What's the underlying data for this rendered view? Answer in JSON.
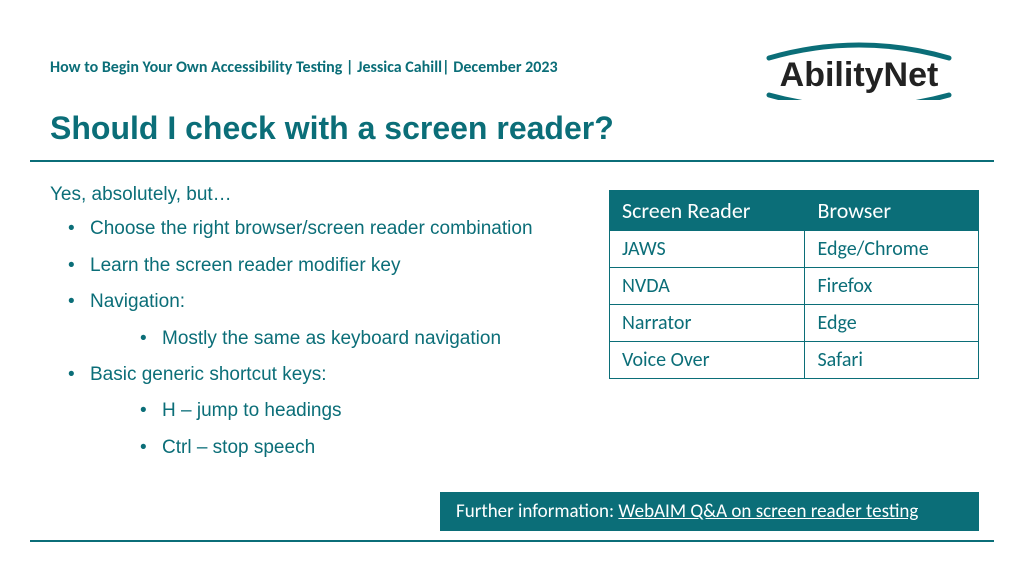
{
  "header": "How to Begin Your Own Accessibility Testing | Jessica Cahill| December 2023",
  "logo_text": "AbilityNet",
  "title": "Should I check with a screen reader?",
  "intro": "Yes, absolutely, but…",
  "bullets": {
    "b1": "Choose the right browser/screen reader combination",
    "b2": "Learn the screen reader modifier key",
    "b3": "Navigation:",
    "b3a": "Mostly the same as keyboard navigation",
    "b4": "Basic generic shortcut keys:",
    "b4a": "H – jump to headings",
    "b4b": "Ctrl – stop speech"
  },
  "table": {
    "h1": "Screen Reader",
    "h2": "Browser",
    "rows": [
      {
        "sr": "JAWS",
        "br": "Edge/Chrome"
      },
      {
        "sr": "NVDA",
        "br": "Firefox"
      },
      {
        "sr": "Narrator",
        "br": "Edge"
      },
      {
        "sr": "Voice Over",
        "br": "Safari"
      }
    ]
  },
  "footer": {
    "prefix": "Further information: ",
    "link": "WebAIM Q&A on screen reader testing"
  }
}
